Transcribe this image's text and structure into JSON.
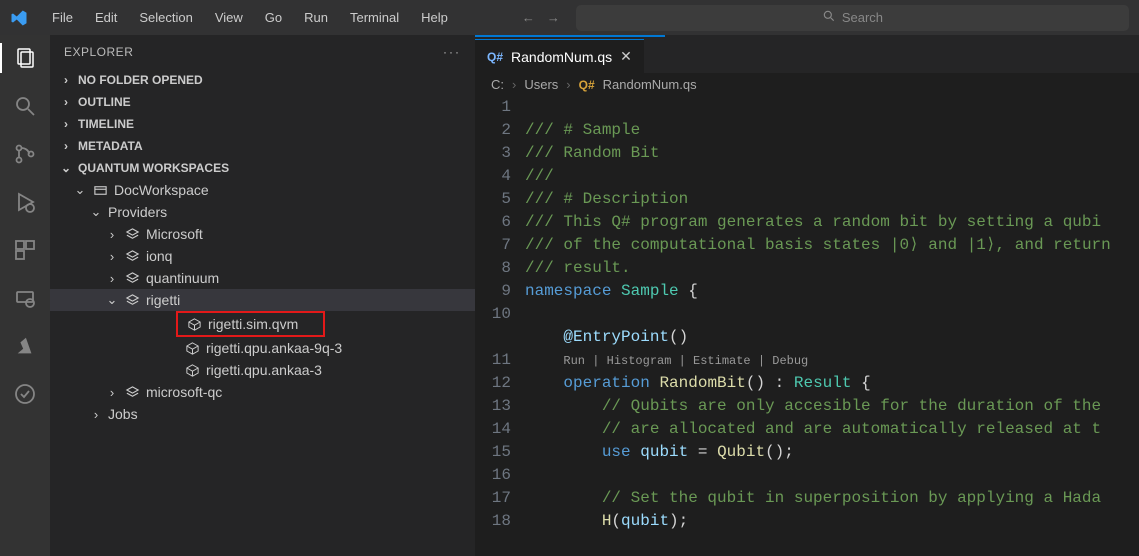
{
  "titlebar": {
    "menu": [
      "File",
      "Edit",
      "Selection",
      "View",
      "Go",
      "Run",
      "Terminal",
      "Help"
    ],
    "search_placeholder": "Search"
  },
  "sidebar": {
    "title": "EXPLORER",
    "sections": {
      "no_folder": "NO FOLDER OPENED",
      "outline": "OUTLINE",
      "timeline": "TIMELINE",
      "metadata": "METADATA",
      "quantum": "QUANTUM WORKSPACES"
    },
    "workspace": "DocWorkspace",
    "providers_label": "Providers",
    "providers": {
      "microsoft": "Microsoft",
      "ionq": "ionq",
      "quantinuum": "quantinuum",
      "rigetti": "rigetti",
      "microsoft_qc": "microsoft-qc"
    },
    "rigetti_targets": {
      "sim_qvm": "rigetti.sim.qvm",
      "ankaa_9q3": "rigetti.qpu.ankaa-9q-3",
      "ankaa_3": "rigetti.qpu.ankaa-3"
    },
    "jobs": "Jobs"
  },
  "editor": {
    "tab": {
      "lang": "Q#",
      "filename": "RandomNum.qs"
    },
    "breadcrumbs": {
      "drive": "C:",
      "folder": "Users",
      "lang": "Q#",
      "file": "RandomNum.qs"
    },
    "codelens": "Run | Histogram | Estimate | Debug",
    "lines": {
      "l1": "/// # Sample",
      "l2": "/// Random Bit",
      "l3": "///",
      "l4": "/// # Description",
      "l5": "/// This Q# program generates a random bit by setting a qubi",
      "l6": "/// of the computational basis states |0⟩ and |1⟩, and return",
      "l7": "/// result.",
      "l8a": "namespace",
      "l8b": "Sample",
      "l8c": "{",
      "l10a": "@EntryPoint",
      "l10b": "()",
      "l11a": "operation",
      "l11b": "RandomBit",
      "l11c": "() : ",
      "l11d": "Result",
      "l11e": " {",
      "l12": "// Qubits are only accesible for the duration of the",
      "l13": "// are allocated and are automatically released at t",
      "l14a": "use",
      "l14b": "qubit",
      "l14c": " = ",
      "l14d": "Qubit",
      "l14e": "();",
      "l16": "// Set the qubit in superposition by applying a Hada",
      "l17a": "H",
      "l17b": "(",
      "l17c": "qubit",
      "l17d": ");"
    },
    "line_numbers": [
      "1",
      "2",
      "3",
      "4",
      "5",
      "6",
      "7",
      "8",
      "9",
      "10",
      "11",
      "12",
      "13",
      "14",
      "15",
      "16",
      "17",
      "18"
    ]
  }
}
